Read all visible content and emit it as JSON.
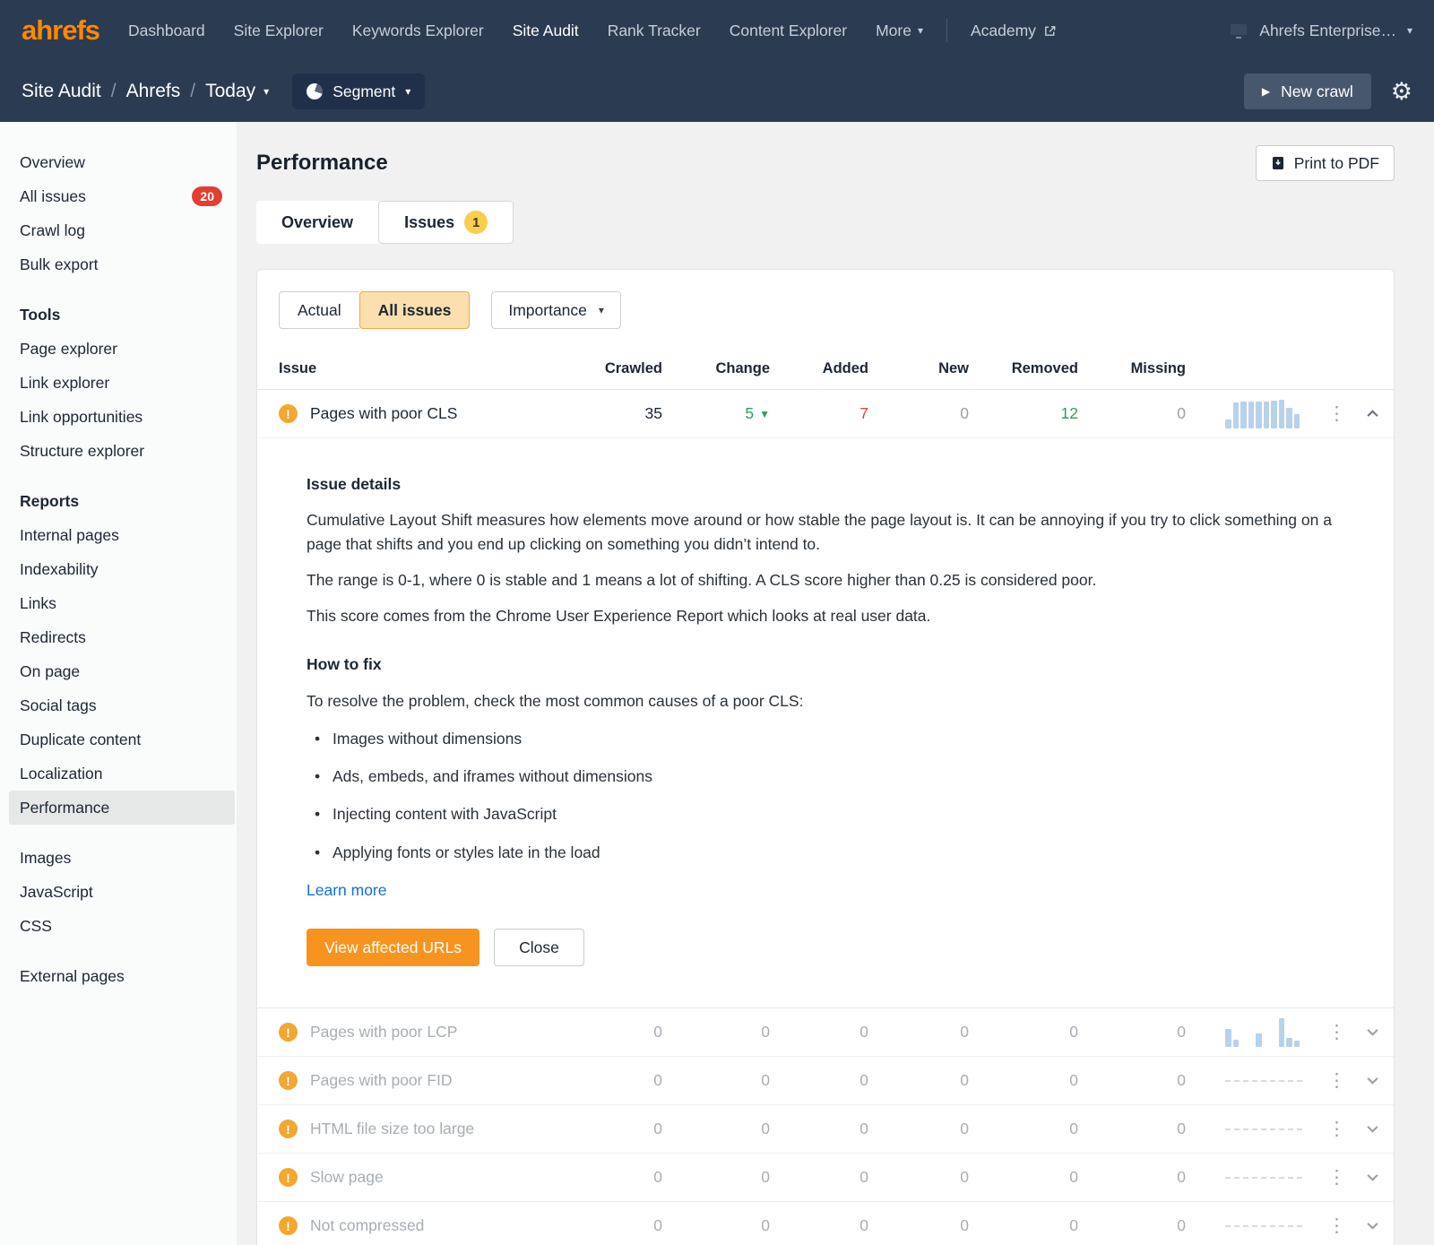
{
  "colors": {
    "brand_orange": "#ff8800",
    "button_orange": "#f7941f",
    "nav_bg": "#2b3b51",
    "badge_red": "#e23e32",
    "badge_yellow": "#f7cf4e",
    "positive_green": "#2e9e5b",
    "negative_red": "#e0442f",
    "link_blue": "#0f6fde",
    "spark_blue": "#b9d2eb"
  },
  "topnav": {
    "logo": "ahrefs",
    "items": [
      {
        "label": "Dashboard"
      },
      {
        "label": "Site Explorer"
      },
      {
        "label": "Keywords Explorer"
      },
      {
        "label": "Site Audit",
        "active": true
      },
      {
        "label": "Rank Tracker"
      },
      {
        "label": "Content Explorer"
      },
      {
        "label": "More"
      }
    ],
    "academy_label": "Academy",
    "account_label": "Ahrefs Enterprise…"
  },
  "subnav": {
    "breadcrumb": [
      "Site Audit",
      "Ahrefs",
      "Today"
    ],
    "breadcrumb_sep": "/",
    "segment_label": "Segment",
    "new_crawl_label": "New crawl"
  },
  "sidebar": {
    "groups": [
      {
        "items": [
          {
            "label": "Overview"
          },
          {
            "label": "All issues",
            "badge": "20"
          },
          {
            "label": "Crawl log"
          },
          {
            "label": "Bulk export"
          }
        ]
      },
      {
        "title": "Tools",
        "items": [
          {
            "label": "Page explorer"
          },
          {
            "label": "Link explorer"
          },
          {
            "label": "Link opportunities"
          },
          {
            "label": "Structure explorer"
          }
        ]
      },
      {
        "title": "Reports",
        "items": [
          {
            "label": "Internal pages"
          },
          {
            "label": "Indexability"
          },
          {
            "label": "Links"
          },
          {
            "label": "Redirects"
          },
          {
            "label": "On page"
          },
          {
            "label": "Social tags"
          },
          {
            "label": "Duplicate content"
          },
          {
            "label": "Localization"
          },
          {
            "label": "Performance",
            "active": true
          }
        ]
      },
      {
        "items": [
          {
            "label": "Images"
          },
          {
            "label": "JavaScript"
          },
          {
            "label": "CSS"
          }
        ]
      },
      {
        "items": [
          {
            "label": "External pages"
          }
        ]
      }
    ]
  },
  "main": {
    "title": "Performance",
    "print_pdf_label": "Print to PDF",
    "tabs": [
      {
        "label": "Overview"
      },
      {
        "label": "Issues",
        "badge": "1",
        "active": true
      }
    ],
    "filters": {
      "actual_label": "Actual",
      "all_issues_label": "All issues",
      "importance_label": "Importance"
    },
    "table": {
      "headers": {
        "issue": "Issue",
        "crawled": "Crawled",
        "change": "Change",
        "added": "Added",
        "new": "New",
        "removed": "Removed",
        "missing": "Missing"
      },
      "rows": [
        {
          "name": "Pages with poor CLS",
          "crawled": "35",
          "change": "5",
          "change_direction": "down",
          "added": "7",
          "new": "0",
          "removed": "12",
          "missing": "0",
          "expanded": true,
          "spark": [
            30,
            88,
            92,
            92,
            92,
            92,
            94,
            100,
            70,
            48
          ]
        },
        {
          "name": "Pages with poor LCP",
          "crawled": "0",
          "change": "0",
          "added": "0",
          "new": "0",
          "removed": "0",
          "missing": "0",
          "spark": [
            60,
            25,
            0,
            0,
            45,
            0,
            0,
            100,
            30,
            20
          ]
        },
        {
          "name": "Pages with poor FID",
          "crawled": "0",
          "change": "0",
          "added": "0",
          "new": "0",
          "removed": "0",
          "missing": "0"
        },
        {
          "name": "HTML file size too large",
          "crawled": "0",
          "change": "0",
          "added": "0",
          "new": "0",
          "removed": "0",
          "missing": "0"
        },
        {
          "name": "Slow page",
          "crawled": "0",
          "change": "0",
          "added": "0",
          "new": "0",
          "removed": "0",
          "missing": "0"
        },
        {
          "name": "Not compressed",
          "crawled": "0",
          "change": "0",
          "added": "0",
          "new": "0",
          "removed": "0",
          "missing": "0"
        }
      ]
    },
    "details": {
      "title": "Issue details",
      "paragraphs": [
        "Cumulative Layout Shift measures how elements move around or how stable the page layout is. It can be annoying if you try to click something on a page that shifts and you end up clicking on something you didn’t intend to.",
        "The range is 0-1, where 0 is stable and 1 means a lot of shifting. A CLS score higher than 0.25 is considered poor.",
        "This score comes from the Chrome User Experience Report which looks at real user data."
      ],
      "how_to_fix_title": "How to fix",
      "how_to_fix_intro": "To resolve the problem, check the most common causes of a poor CLS:",
      "causes": [
        "Images without dimensions",
        "Ads, embeds, and iframes without dimensions",
        "Injecting content with JavaScript",
        "Applying fonts or styles late in the load"
      ],
      "learn_more_label": "Learn more",
      "view_affected_label": "View affected URLs",
      "close_label": "Close"
    }
  }
}
